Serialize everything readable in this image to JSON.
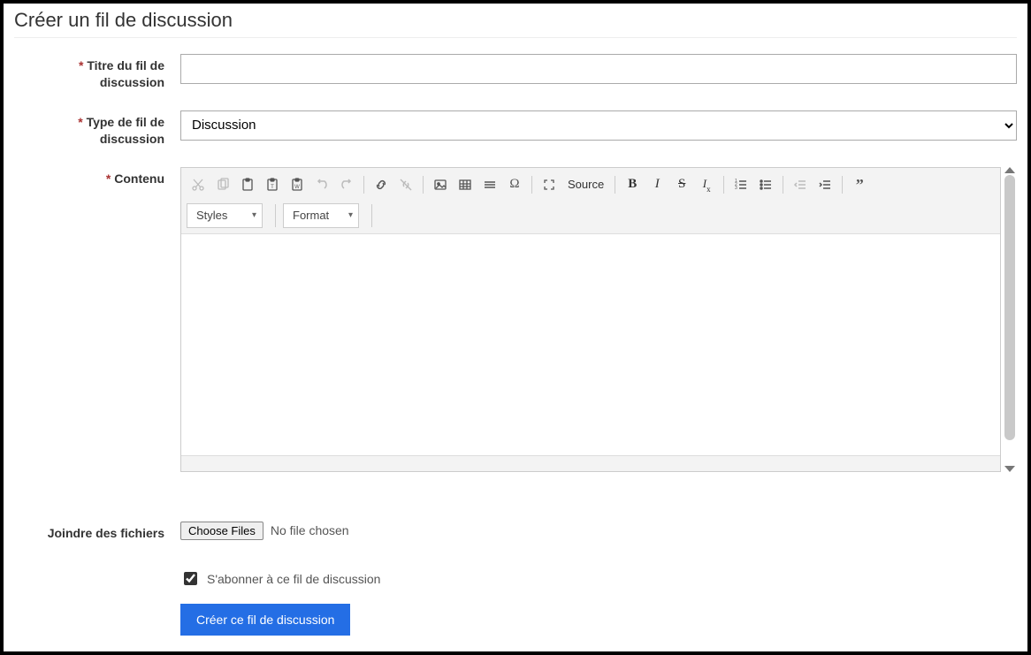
{
  "page": {
    "title": "Créer un fil de discussion"
  },
  "labels": {
    "thread_title": "Titre du fil de discussion",
    "thread_type": "Type de fil de discussion",
    "content": "Contenu",
    "attach": "Joindre des fichiers",
    "required_mark": "*"
  },
  "fields": {
    "title_value": "",
    "type_selected": "Discussion",
    "type_options": [
      "Discussion"
    ]
  },
  "editor": {
    "styles_label": "Styles",
    "format_label": "Format",
    "source_label": "Source",
    "content": ""
  },
  "file": {
    "button_label": "Choose Files",
    "status_text": "No file chosen"
  },
  "subscribe": {
    "label": "S'abonner à ce fil de discussion",
    "checked": true
  },
  "submit": {
    "label": "Créer ce fil de discussion"
  }
}
